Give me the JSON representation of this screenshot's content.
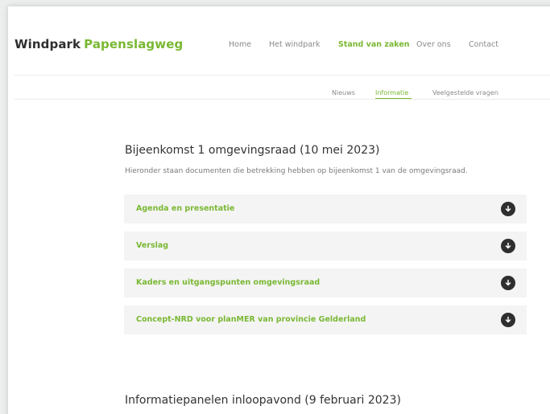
{
  "header": {
    "logo_word1": "Windpark",
    "logo_word2": "Papenslagweg",
    "nav": [
      "Home",
      "Het windpark",
      "Stand van zaken",
      "Over ons",
      "Contact"
    ],
    "nav_active": "Stand van zaken"
  },
  "subnav": {
    "items": [
      "Nieuws",
      "Informatie",
      "Veelgestelde vragen"
    ],
    "active": "Informatie"
  },
  "section1": {
    "title": "Bijeenkomst 1 omgevingsraad (10 mei 2023)",
    "description": "Hieronder staan documenten die betrekking hebben op bijeenkomst 1 van de omgevingsraad.",
    "documents": [
      "Agenda en presentatie",
      "Verslag",
      "Kaders en uitgangspunten omgevingsraad",
      "Concept-NRD voor planMER van provincie Gelderland"
    ]
  },
  "section2": {
    "title": "Informatiepanelen inloopavond (9 februari 2023)"
  },
  "colors": {
    "brand_green": "#7ab833",
    "text_dark": "#333333",
    "download_icon_bg": "#2f2f2f"
  },
  "icons": {
    "download": "download-icon"
  }
}
